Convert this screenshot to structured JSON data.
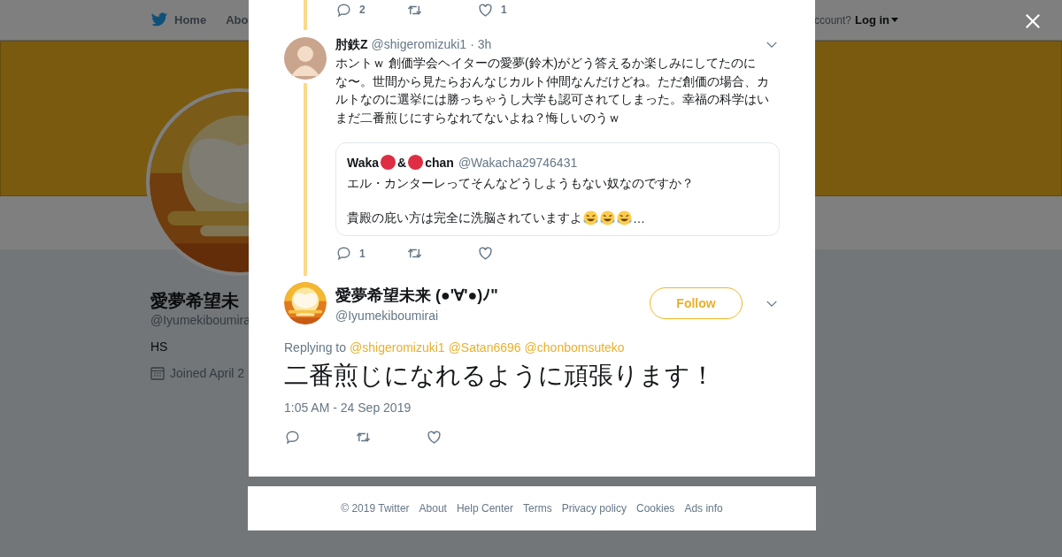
{
  "background_page": {
    "nav": {
      "items": [
        {
          "label": "Home",
          "kind": "home"
        },
        {
          "label": "Abo",
          "kind": "plain"
        }
      ],
      "account_prompt": "ccount?",
      "login": "Log in"
    },
    "profile": {
      "name": "愛夢希望未",
      "handle": "@Iyumekiboumira",
      "bio": "HS",
      "joined": "Joined April 2"
    }
  },
  "modal": {
    "previous_tweet_actions": {
      "replies": "2",
      "likes": "1"
    },
    "reply_tweet": {
      "name": "肘鉄Z",
      "handle": "@shigeromizuki1",
      "time": "· 3h",
      "text": "ホントｗ 創価学会ヘイターの愛夢(鈴木)がどう答えるか楽しみにしてたのにな〜。世間から見たらおんなじカルト仲間なんだけどね。ただ創価の場合、カルトなのに選挙には勝っちゃうし大学も認可されてしまった。幸福の科学はいまだ二番煎じにすらなれてないよね？悔しいのうｗ",
      "quote": {
        "name_parts": [
          "Waka",
          "&",
          "chan"
        ],
        "handle": "@Wakacha29746431",
        "line1": "エル・カンターレってそんなどうしようもない奴なのですか？",
        "line2": "貴殿の庇い方は完全に洗脳されていますよ",
        "trail": "…"
      },
      "actions": {
        "replies": "1"
      }
    },
    "main_tweet": {
      "name": "愛夢希望未来 (●'∀'●)ﾉ\"",
      "handle": "@Iyumekiboumirai",
      "follow": "Follow",
      "replying_label": "Replying to",
      "replying_to": [
        "@shigeromizuki1",
        "@Satan6696",
        "@chonbomsuteko"
      ],
      "text": "二番煎じになれるように頑張ります！",
      "timestamp": "1:05 AM - 24 Sep 2019"
    }
  },
  "footer": {
    "links": [
      "© 2019 Twitter",
      "About",
      "Help Center",
      "Terms",
      "Privacy policy",
      "Cookies",
      "Ads info"
    ]
  }
}
